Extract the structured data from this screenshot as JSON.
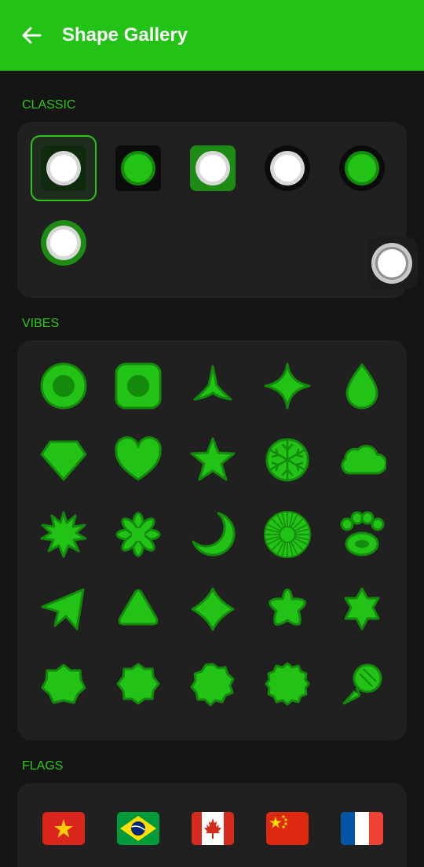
{
  "appbar": {
    "title": "Shape Gallery"
  },
  "sections": {
    "classic": {
      "label": "CLASSIC",
      "items": [
        "classic-square-outline",
        "classic-square-green",
        "classic-rounded-green",
        "classic-circle-outline",
        "classic-circle-green",
        "classic-circle-ring"
      ]
    },
    "vibes": {
      "label": "VIBES",
      "items": [
        "circle-dot",
        "square-dot",
        "tri-arrow",
        "four-point-star",
        "droplet",
        "diamond",
        "heart",
        "star",
        "snowflake",
        "cloud",
        "burst-leaf",
        "flower-petals",
        "crescent-moon",
        "sun-ray",
        "paw",
        "paper-plane",
        "rounded-triangle",
        "clover-four",
        "rounded-star-five",
        "rounded-star-six",
        "scallop-seven",
        "scallop-eight",
        "scallop-nine",
        "scallop-ten",
        "ice-cream-cone"
      ]
    },
    "flags": {
      "label": "FLAGS",
      "items": [
        "vietnam-flag",
        "brazil-flag",
        "canada-flag",
        "china-flag",
        "france-flag"
      ]
    }
  },
  "colors": {
    "accent": "#22c216",
    "accent_text": "#2ec51b",
    "fill": "#22c216",
    "stroke": "#148a0c",
    "card": "#202020",
    "background": "#151515"
  }
}
